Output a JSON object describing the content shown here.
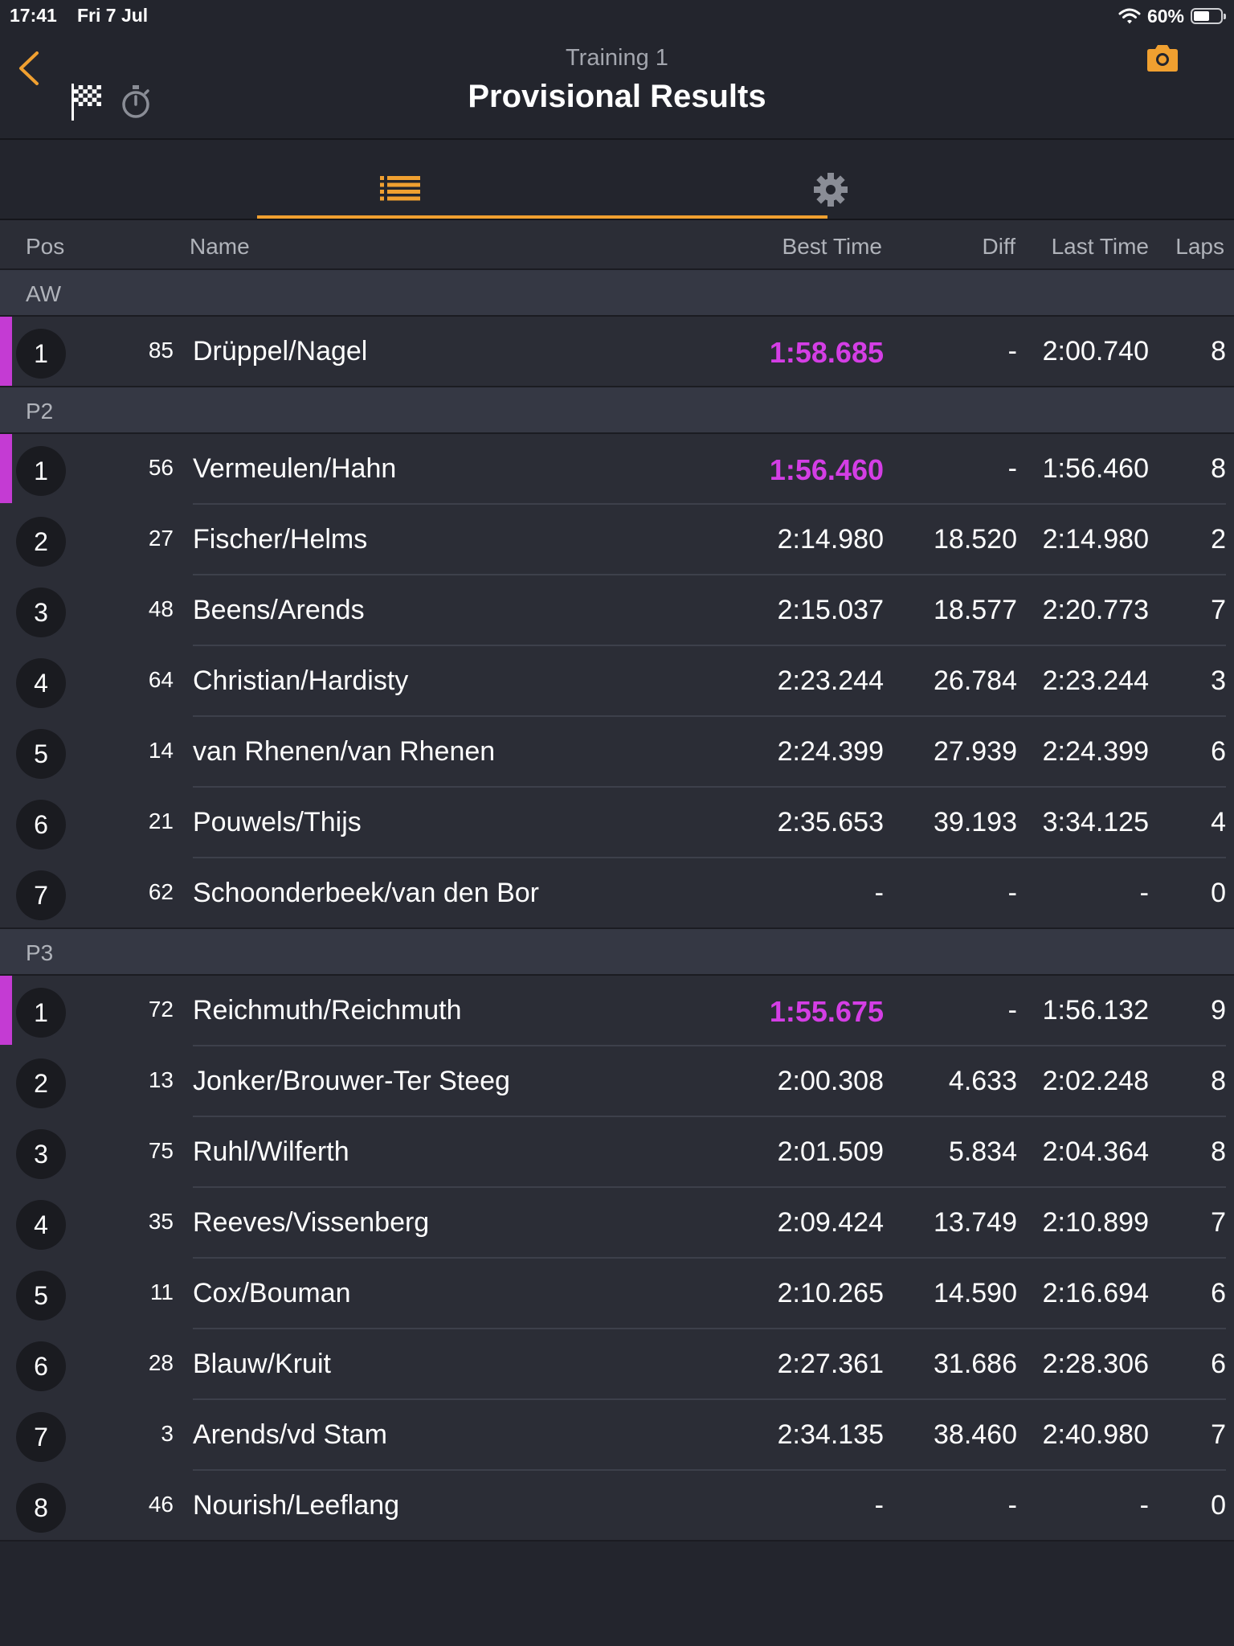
{
  "status_bar": {
    "time": "17:41",
    "date": "Fri 7 Jul",
    "battery_percent": "60%",
    "battery_level": 0.6
  },
  "nav": {
    "subtitle": "Training 1",
    "title": "Provisional Results"
  },
  "icons": {
    "back": "chevron-left-icon",
    "flag": "checkered-flag-icon",
    "stopwatch": "stopwatch-icon",
    "camera": "camera-icon",
    "list": "list-icon",
    "settings": "gear-icon"
  },
  "colors": {
    "accent": "#f0a030",
    "fastest": "#d43ee5",
    "leader_bar": "#c43bd3"
  },
  "columns": {
    "pos": "Pos",
    "name": "Name",
    "best": "Best Time",
    "diff": "Diff",
    "last": "Last Time",
    "laps": "Laps"
  },
  "groups": [
    {
      "name": "AW",
      "rows": [
        {
          "pos": "1",
          "num": "85",
          "name": "Drüppel/Nagel",
          "best": "1:58.685",
          "diff": "-",
          "last": "2:00.740",
          "laps": "8",
          "leader": true
        }
      ]
    },
    {
      "name": "P2",
      "rows": [
        {
          "pos": "1",
          "num": "56",
          "name": "Vermeulen/Hahn",
          "best": "1:56.460",
          "diff": "-",
          "last": "1:56.460",
          "laps": "8",
          "leader": true
        },
        {
          "pos": "2",
          "num": "27",
          "name": "Fischer/Helms",
          "best": "2:14.980",
          "diff": "18.520",
          "last": "2:14.980",
          "laps": "2",
          "leader": false
        },
        {
          "pos": "3",
          "num": "48",
          "name": "Beens/Arends",
          "best": "2:15.037",
          "diff": "18.577",
          "last": "2:20.773",
          "laps": "7",
          "leader": false
        },
        {
          "pos": "4",
          "num": "64",
          "name": "Christian/Hardisty",
          "best": "2:23.244",
          "diff": "26.784",
          "last": "2:23.244",
          "laps": "3",
          "leader": false
        },
        {
          "pos": "5",
          "num": "14",
          "name": "van Rhenen/van Rhenen",
          "best": "2:24.399",
          "diff": "27.939",
          "last": "2:24.399",
          "laps": "6",
          "leader": false
        },
        {
          "pos": "6",
          "num": "21",
          "name": "Pouwels/Thijs",
          "best": "2:35.653",
          "diff": "39.193",
          "last": "3:34.125",
          "laps": "4",
          "leader": false
        },
        {
          "pos": "7",
          "num": "62",
          "name": "Schoonderbeek/van den Bor",
          "best": "-",
          "diff": "-",
          "last": "-",
          "laps": "0",
          "leader": false
        }
      ]
    },
    {
      "name": "P3",
      "rows": [
        {
          "pos": "1",
          "num": "72",
          "name": "Reichmuth/Reichmuth",
          "best": "1:55.675",
          "diff": "-",
          "last": "1:56.132",
          "laps": "9",
          "leader": true
        },
        {
          "pos": "2",
          "num": "13",
          "name": "Jonker/Brouwer-Ter Steeg",
          "best": "2:00.308",
          "diff": "4.633",
          "last": "2:02.248",
          "laps": "8",
          "leader": false
        },
        {
          "pos": "3",
          "num": "75",
          "name": "Ruhl/Wilferth",
          "best": "2:01.509",
          "diff": "5.834",
          "last": "2:04.364",
          "laps": "8",
          "leader": false
        },
        {
          "pos": "4",
          "num": "35",
          "name": "Reeves/Vissenberg",
          "best": "2:09.424",
          "diff": "13.749",
          "last": "2:10.899",
          "laps": "7",
          "leader": false
        },
        {
          "pos": "5",
          "num": "11",
          "name": "Cox/Bouman",
          "best": "2:10.265",
          "diff": "14.590",
          "last": "2:16.694",
          "laps": "6",
          "leader": false
        },
        {
          "pos": "6",
          "num": "28",
          "name": "Blauw/Kruit",
          "best": "2:27.361",
          "diff": "31.686",
          "last": "2:28.306",
          "laps": "6",
          "leader": false
        },
        {
          "pos": "7",
          "num": "3",
          "name": "Arends/vd Stam",
          "best": "2:34.135",
          "diff": "38.460",
          "last": "2:40.980",
          "laps": "7",
          "leader": false
        },
        {
          "pos": "8",
          "num": "46",
          "name": "Nourish/Leeflang",
          "best": "-",
          "diff": "-",
          "last": "-",
          "laps": "0",
          "leader": false
        }
      ]
    }
  ]
}
